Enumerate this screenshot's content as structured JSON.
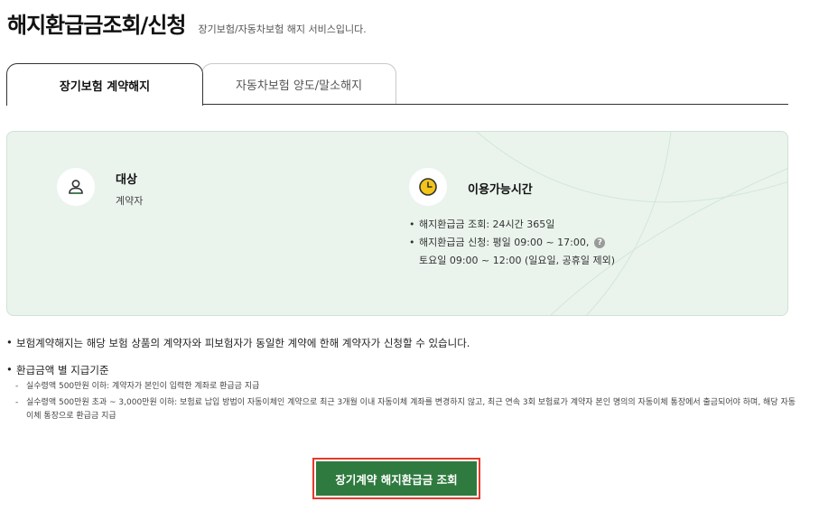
{
  "header": {
    "title": "해지환급금조회/신청",
    "subtitle": "장기보험/자동차보험 해지 서비스입니다."
  },
  "tabs": [
    {
      "label": "장기보험 계약해지",
      "active": true
    },
    {
      "label": "자동차보험 양도/말소해지",
      "active": false
    }
  ],
  "info": {
    "target": {
      "icon": "person-icon",
      "title": "대상",
      "desc": "계약자"
    },
    "hours": {
      "icon": "clock-icon",
      "title": "이용가능시간",
      "items": [
        "해지환급금 조회: 24시간 365일",
        "해지환급금 신청: 평일 09:00 ~ 17:00,",
        "토요일 09:00 ~ 12:00 (일요일, 공휴일 제외)"
      ],
      "help_icon": "help-icon",
      "help_glyph": "?"
    }
  },
  "notes": {
    "main1": "보험계약해지는 해당 보험 상품의 계약자와 피보험자가 동일한 계약에 한해 계약자가 신청할 수 있습니다.",
    "main2": "환급금액 별 지급기준",
    "sub": [
      "실수령액 500만원 이하: 계약자가 본인이 입력한 계좌로 환급금 지급",
      "실수령액 500만원 초과 ~ 3,000만원 이하: 보험료 납입 방법이 자동이체인 계약으로 최근 3개월 이내 자동이체 계좌를 변경하지 않고, 최근 연속 3회 보험료가 계약자 본인 명의의 자동이체 통장에서 출금되어야 하며, 해당 자동이체 통장으로 환급금 지급"
    ]
  },
  "cta": {
    "label": "장기계약 해지환급금 조회"
  },
  "colors": {
    "brand_green": "#2f7a3f",
    "panel_bg": "#eaf4ed",
    "highlight_red": "#e53a2c",
    "clock_yellow": "#f2c318"
  }
}
